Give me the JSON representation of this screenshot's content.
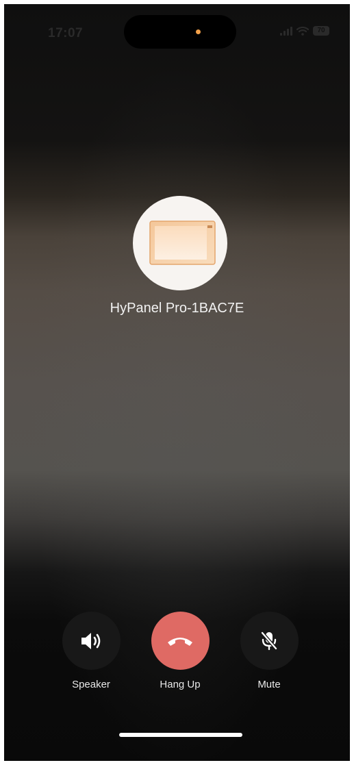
{
  "status_bar": {
    "time": "17:07",
    "battery": "70"
  },
  "caller": {
    "name": "HyPanel Pro-1BAC7E",
    "avatar_icon": "display-panel-icon"
  },
  "controls": [
    {
      "label": "Speaker",
      "icon": "speaker-icon"
    },
    {
      "label": "Hang Up",
      "icon": "phone-hangup-icon",
      "color": "#df6a64"
    },
    {
      "label": "Mute",
      "icon": "microphone-muted-icon"
    }
  ],
  "colors": {
    "hangup": "#df6a64",
    "island_indicator": "#f3a14a",
    "control_background": "#181818"
  }
}
